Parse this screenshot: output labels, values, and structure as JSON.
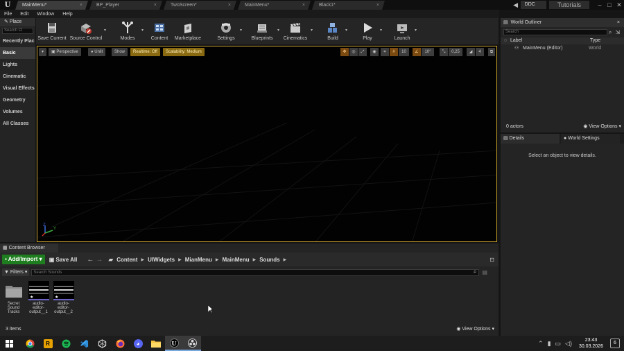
{
  "tabs": [
    {
      "label": "MainMenu*",
      "active": true
    },
    {
      "label": "BP_Player",
      "active": false
    },
    {
      "label": "TwoScreen*",
      "active": false
    },
    {
      "label": "MainMenu*",
      "active": false
    },
    {
      "label": "Black1*",
      "active": false
    }
  ],
  "titlebar": {
    "project": "DDC",
    "tutorials": "Tutorials"
  },
  "menu": [
    "File",
    "Edit",
    "Window",
    "Help"
  ],
  "place": {
    "tab_label": "Place",
    "search_placeholder": "Search Cl",
    "categories": [
      "Recently Plac",
      "Basic",
      "Lights",
      "Cinematic",
      "Visual Effects",
      "Geometry",
      "Volumes",
      "All Classes"
    ]
  },
  "toolbar": {
    "buttons": [
      "Save Current",
      "Source Control",
      "Modes",
      "Content",
      "Marketplace",
      "Settings",
      "Blueprints",
      "Cinematics",
      "Build",
      "Play",
      "Launch"
    ]
  },
  "viewport": {
    "perspective": "Perspective",
    "unlit": "Unlit",
    "show": "Show",
    "realtime": "Realtime: Off",
    "scalability": "Scalability: Medium",
    "grid_snap": "10",
    "rotation_snap": "10°",
    "scale_snap": "0,25",
    "camera_speed": "4",
    "axis_y": "Y",
    "axis_z": "Z"
  },
  "outliner": {
    "tab": "World Outliner",
    "search_placeholder": "Search",
    "col_label": "Label",
    "col_type": "Type",
    "row_label": "MainMenu (Editor)",
    "row_type": "World",
    "actor_count": "0 actors",
    "view_options": "View Options"
  },
  "details": {
    "tab_details": "Details",
    "tab_world_settings": "World Settings",
    "message": "Select an object to view details."
  },
  "content_browser": {
    "tab": "Content Browser",
    "add_import": "Add/Import",
    "save_all": "Save All",
    "breadcrumbs": [
      "Content",
      "UIWidgets",
      "MianMenu",
      "MainMenu",
      "Sounds"
    ],
    "filters": "Filters",
    "search_placeholder": "Search Sounds",
    "assets": [
      {
        "name": "Secret Sound Tracks",
        "kind": "folder"
      },
      {
        "name": "audio-editor-output__1",
        "kind": "sound"
      },
      {
        "name": "audio-editor-output__2",
        "kind": "sound"
      }
    ],
    "item_count": "3 items",
    "view_options": "View Options"
  },
  "taskbar": {
    "time": "23:43",
    "date": "30.03.2026",
    "notifications": "6"
  }
}
